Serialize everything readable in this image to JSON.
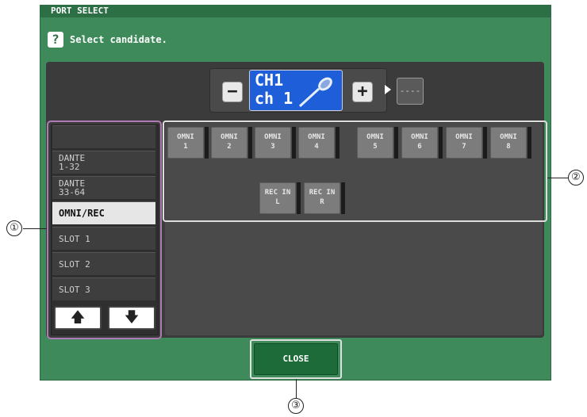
{
  "dialog": {
    "title": "PORT SELECT",
    "help_icon": "?",
    "hint": "Select candidate."
  },
  "channel": {
    "minus_label": "−",
    "plus_label": "+",
    "number": "CH1",
    "name": "ch 1",
    "icon": "microphone-icon",
    "patch_label": "----"
  },
  "list": {
    "items": [
      "",
      "DANTE\n1-32",
      "DANTE\n33-64",
      "OMNI/REC",
      "SLOT 1",
      "SLOT 2",
      "SLOT 3"
    ],
    "selected": "OMNI/REC",
    "up_label": "🡅",
    "down_label": "🡇"
  },
  "ports": {
    "row1": [
      "OMNI\n1",
      "OMNI\n2",
      "OMNI\n3",
      "OMNI\n4",
      "OMNI\n5",
      "OMNI\n6",
      "OMNI\n7",
      "OMNI\n8"
    ],
    "row2": [
      "REC IN\nL",
      "REC IN\nR"
    ]
  },
  "close_label": "CLOSE",
  "callouts": [
    "①",
    "②",
    "③"
  ],
  "colors": {
    "window": "#3f8a5a",
    "titlebar": "#2c6f45",
    "channel_display": "#1e5fd9",
    "list_highlight": "#b07ab6",
    "close_button": "#1e6b3a"
  }
}
